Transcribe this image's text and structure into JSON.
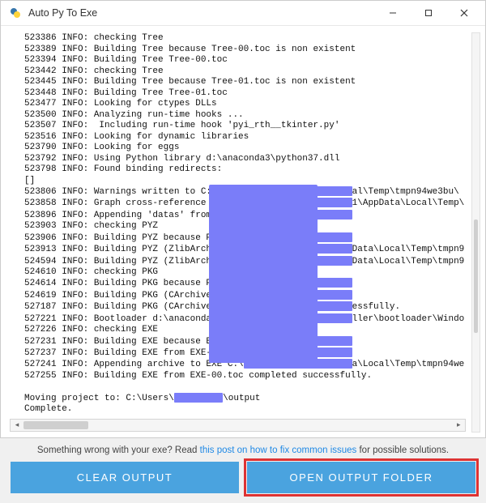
{
  "window": {
    "title": "Auto Py To Exe"
  },
  "log_lines": [
    "523386 INFO: checking Tree",
    "523389 INFO: Building Tree because Tree-00.toc is non existent",
    "523394 INFO: Building Tree Tree-00.toc",
    "523442 INFO: checking Tree",
    "523445 INFO: Building Tree because Tree-01.toc is non existent",
    "523448 INFO: Building Tree Tree-01.toc",
    "523477 INFO: Looking for ctypes DLLs",
    "523500 INFO: Analyzing run-time hooks ...",
    "523507 INFO:  Including run-time hook 'pyi_rth__tkinter.py'",
    "523516 INFO: Looking for dynamic libraries",
    "523790 INFO: Looking for eggs",
    "523792 INFO: Using Python library d:\\anaconda3\\python37.dll",
    "523798 INFO: Found binding redirects:",
    "[]",
    "523806 INFO: Warnings written to C:\\Users␟al\\Temp\\tmpn94we3bu\\",
    "523858 INFO: Graph cross-reference writte␟1\\AppData\\Local\\Temp\\",
    "523896 INFO: Appending 'datas' from .spec␟",
    "523903 INFO: checking PYZ",
    "523906 INFO: Building PYZ because PYZ-00.␟",
    "523913 INFO: Building PYZ (ZlibArchive) C␟Data\\Local\\Temp\\tmpn9",
    "524594 INFO: Building PYZ (ZlibArchive) C␟Data\\Local\\Temp\\tmpn9",
    "524610 INFO: checking PKG",
    "524614 INFO: Building PKG because PKG-00.␟",
    "524619 INFO: Building PKG (CArchive) PKG-␟",
    "527187 INFO: Building PKG (CArchive) PKG-␟essfully.",
    "527221 INFO: Bootloader d:\\anaconda3\\lib\\␟ller\\bootloader\\Windo",
    "527226 INFO: checking EXE",
    "527231 INFO: Building EXE because EXE-00.␟",
    "527237 INFO: Building EXE from EXE-00.toc␟",
    "527241 INFO: Appending archive to EXE C:\\␟a\\Local\\Temp\\tmpn94we",
    "527255 INFO: Building EXE from EXE-00.toc completed successfully.",
    "",
    "Moving project to: C:\\Users\\▇▇▇▇▇▇\\output",
    "Complete."
  ],
  "redact_big": {
    "left_col": 34,
    "top_line": 14,
    "width_ch": 20,
    "height_lines": 16
  },
  "help": {
    "prefix": "Something wrong with your exe? Read ",
    "link": "this post on how to fix common issues",
    "suffix": " for possible solutions."
  },
  "buttons": {
    "clear": "CLEAR OUTPUT",
    "open": "OPEN OUTPUT FOLDER"
  }
}
